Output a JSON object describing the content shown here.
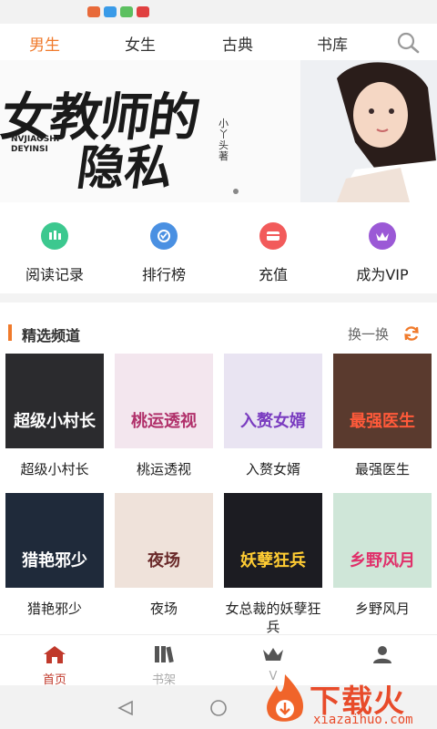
{
  "top_tabs": [
    {
      "label": "男生",
      "active": true
    },
    {
      "label": "女生",
      "active": false
    },
    {
      "label": "古典",
      "active": false
    },
    {
      "label": "书库",
      "active": false
    }
  ],
  "banner": {
    "title_line1": "女教师的",
    "title_line2": "隐私",
    "subtitle_line1": "NVJIAOSHI",
    "subtitle_line2": "DEYINSI",
    "author": "小丫头著"
  },
  "quick_actions": [
    {
      "label": "阅读记录",
      "icon": "reading-record-icon",
      "color": "#3cc88f"
    },
    {
      "label": "排行榜",
      "icon": "ranking-icon",
      "color": "#4a90e2"
    },
    {
      "label": "充值",
      "icon": "recharge-icon",
      "color": "#f25b5b"
    },
    {
      "label": "成为VIP",
      "icon": "vip-icon",
      "color": "#9b59d6"
    }
  ],
  "section": {
    "title": "精选频道",
    "refresh_label": "换一换"
  },
  "books": [
    {
      "title": "超级小村长",
      "cover_text": "超级小村长",
      "bg": "#2b2b2e",
      "fg": "#ffffff"
    },
    {
      "title": "桃运透视",
      "cover_text": "桃运透视",
      "bg": "#f3e6ee",
      "fg": "#b0306a"
    },
    {
      "title": "入赘女婿",
      "cover_text": "入赘女婿",
      "bg": "#e9e4f2",
      "fg": "#7a3cc0"
    },
    {
      "title": "最强医生",
      "cover_text": "最强医生",
      "bg": "#5a3a2e",
      "fg": "#ff5a3a"
    },
    {
      "title": "猎艳邪少",
      "cover_text": "猎艳邪少",
      "bg": "#1f2a3a",
      "fg": "#ffffff"
    },
    {
      "title": "夜场",
      "cover_text": "夜场",
      "bg": "#efe2da",
      "fg": "#6a2a2a"
    },
    {
      "title": "女总裁的妖孽狂兵",
      "cover_text": "妖孽狂兵",
      "bg": "#1c1c22",
      "fg": "#ffcc33"
    },
    {
      "title": "乡野风月",
      "cover_text": "乡野风月",
      "bg": "#cfe6d8",
      "fg": "#e0306a"
    }
  ],
  "bottom_nav": [
    {
      "label": "首页",
      "icon": "home-icon",
      "active": true
    },
    {
      "label": "书架",
      "icon": "bookshelf-icon",
      "active": false
    },
    {
      "label": "V",
      "icon": "vip-crown-icon",
      "active": false
    },
    {
      "label": "",
      "icon": "user-icon",
      "active": false
    }
  ],
  "watermark": {
    "text": "下载火",
    "url": "xiazaihuo.com"
  },
  "colors": {
    "accent": "#f07a2b",
    "nav_active": "#c0392b"
  }
}
